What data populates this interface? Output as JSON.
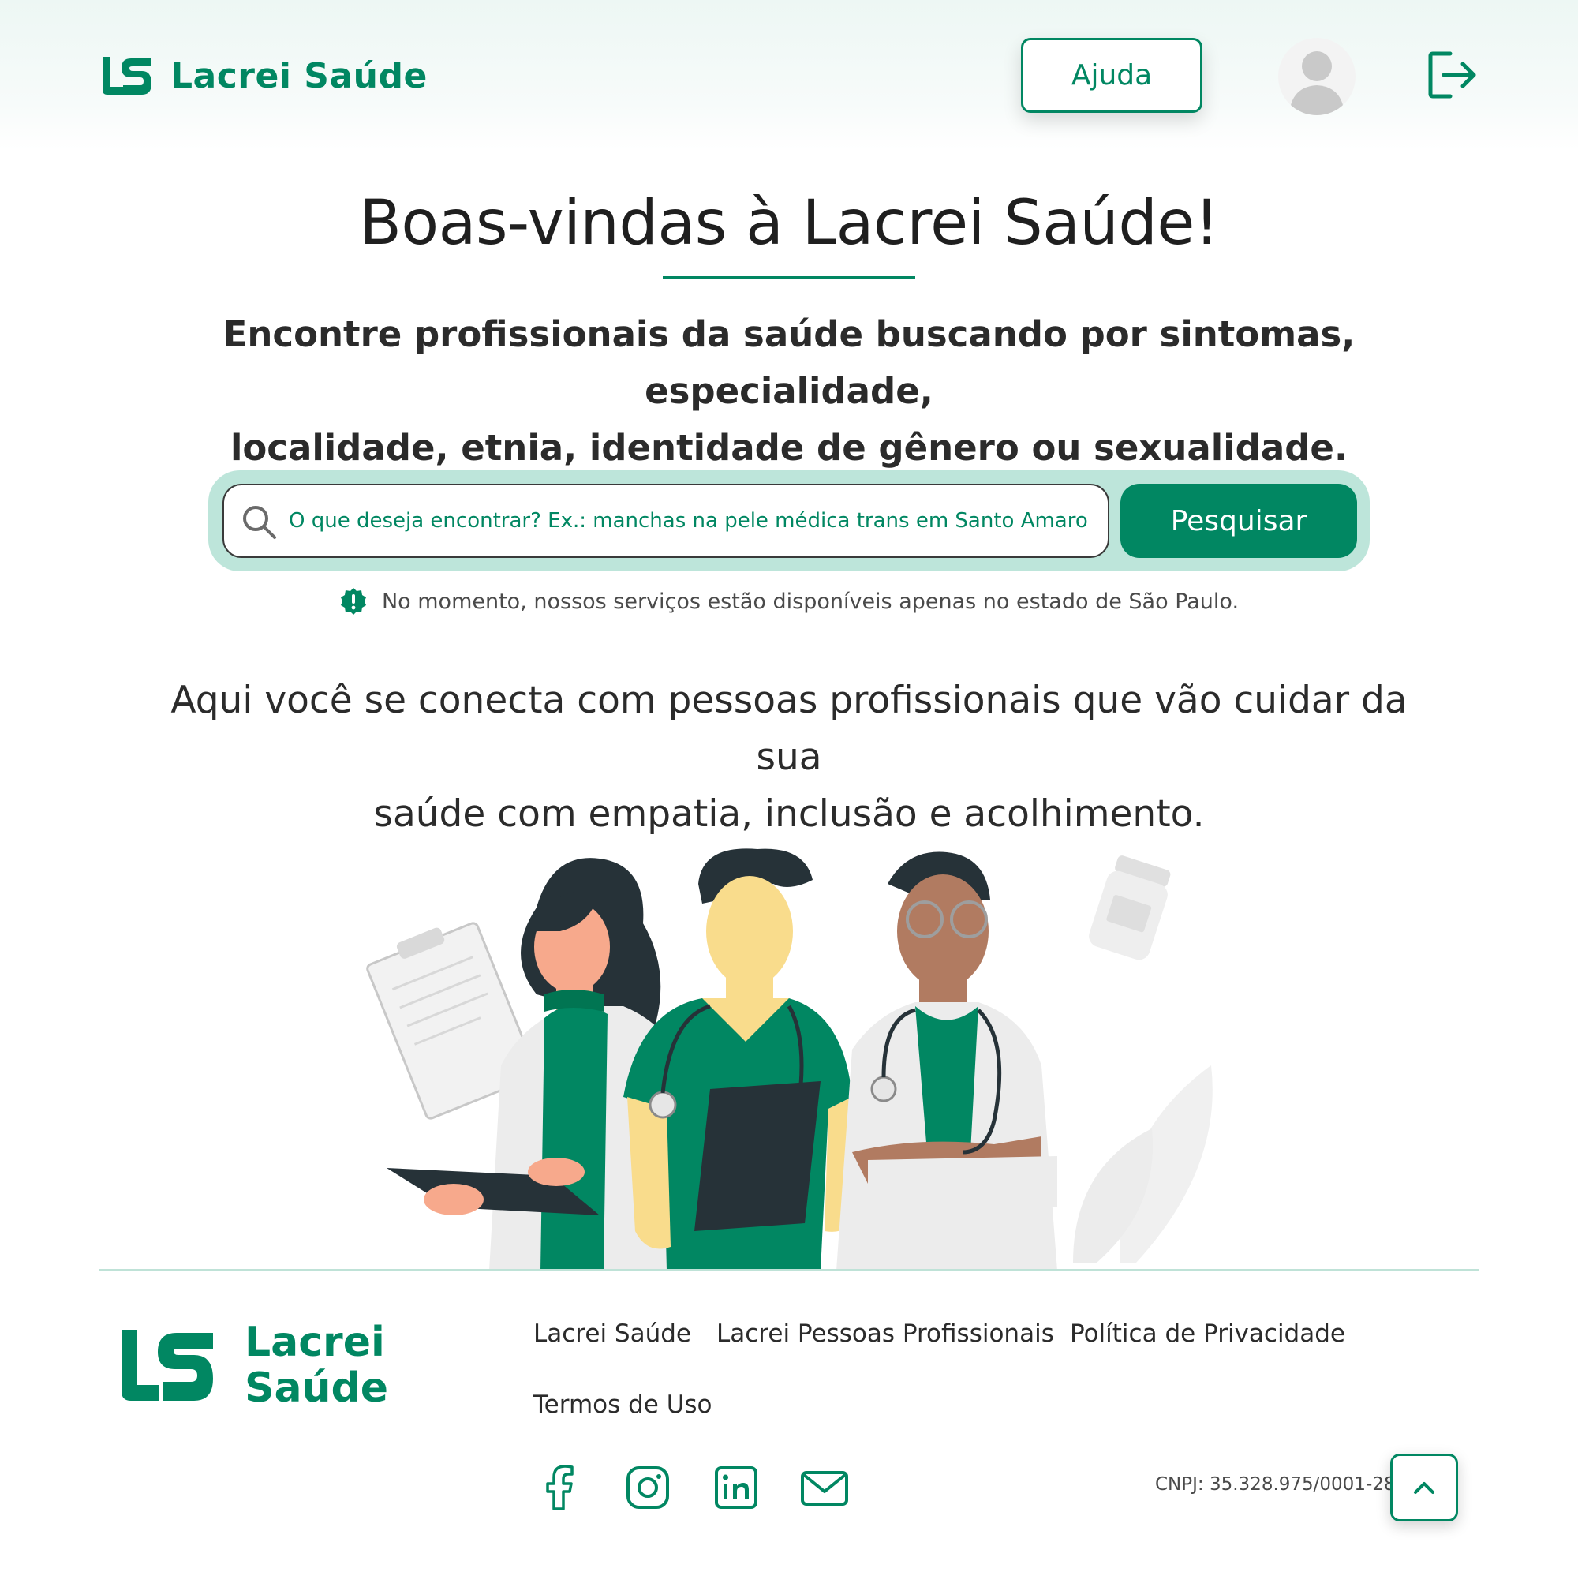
{
  "header": {
    "brand": "Lacrei Saúde",
    "help_label": "Ajuda",
    "avatar_icon": "user-avatar-icon",
    "logout_icon": "logout-icon"
  },
  "hero": {
    "title": "Boas-vindas à Lacrei Saúde!",
    "subtitle_line1": "Encontre profissionais da saúde buscando por sintomas, especialidade,",
    "subtitle_line2": "localidade, etnia, identidade de gênero ou sexualidade."
  },
  "search": {
    "placeholder": "O que deseja encontrar? Ex.: manchas na pele médica trans em Santo Amaro",
    "button_label": "Pesquisar",
    "notice": "No momento, nossos serviços estão disponíveis apenas no estado de São Paulo."
  },
  "tagline": {
    "line1": "Aqui você se conecta com pessoas profissionais que vão cuidar da sua",
    "line2": "saúde com empatia, inclusão e acolhimento."
  },
  "footer": {
    "brand_line1": "Lacrei",
    "brand_line2": "Saúde",
    "links": [
      {
        "label": "Lacrei Saúde"
      },
      {
        "label": "Lacrei Pessoas Profissionais"
      },
      {
        "label": "Política de Privacidade"
      },
      {
        "label": "Termos de Uso"
      }
    ],
    "social": [
      "facebook-icon",
      "instagram-icon",
      "linkedin-icon",
      "mail-icon"
    ],
    "cnpj": "CNPJ: 35.328.975/0001-28",
    "back_to_top_icon": "chevron-up-icon"
  },
  "colors": {
    "brand_green": "#018762",
    "search_frame": "#bde5da",
    "header_bg": "#edf7f4"
  }
}
